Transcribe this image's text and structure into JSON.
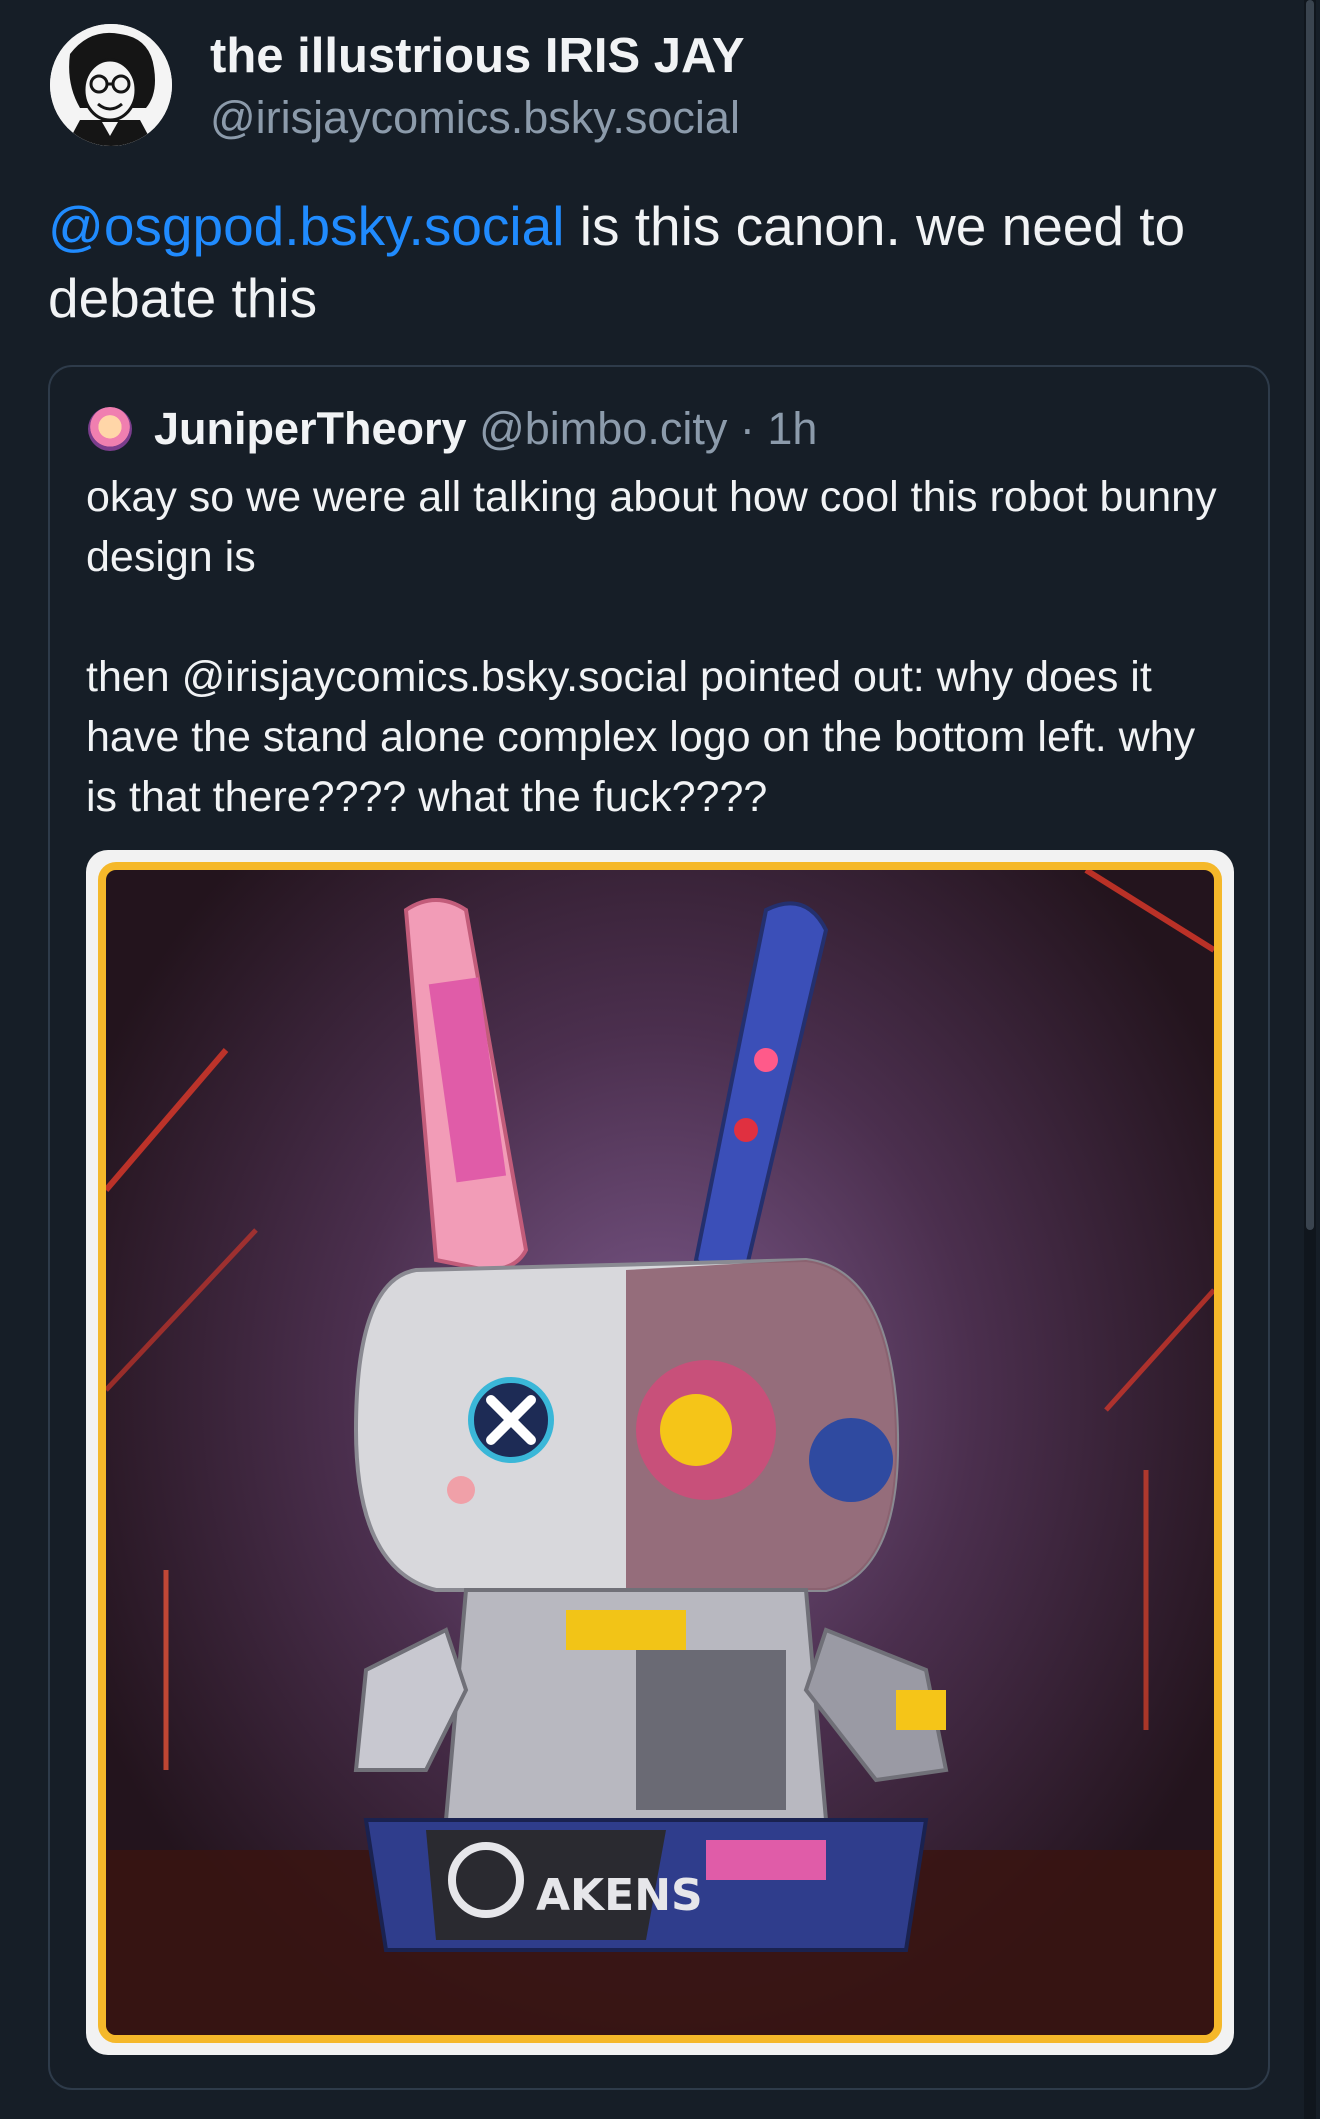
{
  "post": {
    "display_name": "the illustrious IRIS JAY",
    "handle": "@irisjaycomics.bsky.social",
    "text_mention": "@osgpod.bsky.social",
    "text_body": " is this canon. we need to debate this"
  },
  "quote": {
    "display_name": "JuniperTheory",
    "handle": "@bimbo.city",
    "separator": " · ",
    "time": "1h",
    "text": "okay so we were all talking about how cool this robot bunny design is\n\nthen @irisjaycomics.bsky.social pointed out: why does it have the stand alone complex logo on the bottom left. why is that there???? what the fuck????",
    "image_logo_text": "AKENS"
  },
  "colors": {
    "background": "#161e27",
    "mention": "#208bfe",
    "muted": "#8c9bab",
    "frame_accent": "#f5b82a"
  }
}
